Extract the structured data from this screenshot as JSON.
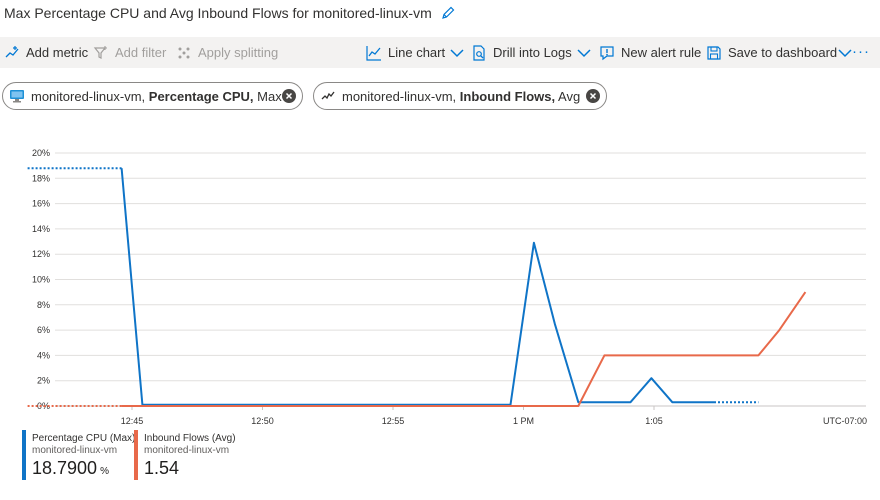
{
  "header": {
    "title": "Max Percentage CPU and Avg Inbound Flows for monitored-linux-vm"
  },
  "icons": {
    "edit": "pencil-icon"
  },
  "toolbar": {
    "add_metric": "Add metric",
    "add_filter": "Add filter",
    "apply_splitting": "Apply splitting",
    "line_chart": "Line chart",
    "drill_into_logs": "Drill into Logs",
    "new_alert_rule": "New alert rule",
    "save_to_dashboard": "Save to dashboard",
    "more": "···"
  },
  "pills": [
    {
      "resource": "monitored-linux-vm,",
      "metric": "Percentage CPU,",
      "aggregation": "Max"
    },
    {
      "resource": "monitored-linux-vm,",
      "metric": "Inbound Flows,",
      "aggregation": "Avg"
    }
  ],
  "colors": {
    "cpu": "#0f74c7",
    "flows": "#e8694a",
    "accent": "#0078d4"
  },
  "chart_data": {
    "type": "line",
    "yticks": [
      "0%",
      "2%",
      "4%",
      "6%",
      "8%",
      "10%",
      "12%",
      "14%",
      "16%",
      "18%",
      "20%"
    ],
    "ylim": [
      0,
      20
    ],
    "xlim": [
      0,
      27.5
    ],
    "xticks": [
      {
        "label": "12:45",
        "x": 4
      },
      {
        "label": "12:50",
        "x": 9
      },
      {
        "label": "12:55",
        "x": 14
      },
      {
        "label": "1 PM",
        "x": 19
      },
      {
        "label": "1:05",
        "x": 24
      }
    ],
    "timezone": "UTC-07:00",
    "grid": true,
    "series": [
      {
        "name": "Percentage CPU (Max)",
        "color": "#0f74c7",
        "leading_dotted": [
          [
            0,
            18.8
          ],
          [
            3.6,
            18.8
          ]
        ],
        "values": [
          [
            3.6,
            18.8
          ],
          [
            4.4,
            0.1
          ],
          [
            18.5,
            0.1
          ],
          [
            19.4,
            12.9
          ],
          [
            20.2,
            6.5
          ],
          [
            21.1,
            0.3
          ],
          [
            22.1,
            0.3
          ],
          [
            23.1,
            0.3
          ],
          [
            23.9,
            2.2
          ],
          [
            24.7,
            0.3
          ],
          [
            25.5,
            0.3
          ],
          [
            26.3,
            0.3
          ]
        ],
        "trailing_dotted": [
          [
            26.3,
            0.3
          ],
          [
            28.0,
            0.3
          ]
        ]
      },
      {
        "name": "Inbound Flows (Avg)",
        "color": "#e8694a",
        "leading_dotted": [
          [
            0,
            0
          ],
          [
            3.6,
            0
          ]
        ],
        "values": [
          [
            3.6,
            0
          ],
          [
            21.1,
            0
          ],
          [
            22.1,
            4.0
          ],
          [
            28.0,
            4.0
          ],
          [
            28.8,
            6.0
          ],
          [
            29.8,
            9.0
          ]
        ]
      }
    ]
  },
  "legend": [
    {
      "name": "Percentage CPU (Max)",
      "resource": "monitored-linux-vm",
      "value": "18.7900",
      "unit": "%",
      "color": "#0f74c7"
    },
    {
      "name": "Inbound Flows (Avg)",
      "resource": "monitored-linux-vm",
      "value": "1.54",
      "unit": "",
      "color": "#e8694a"
    }
  ]
}
